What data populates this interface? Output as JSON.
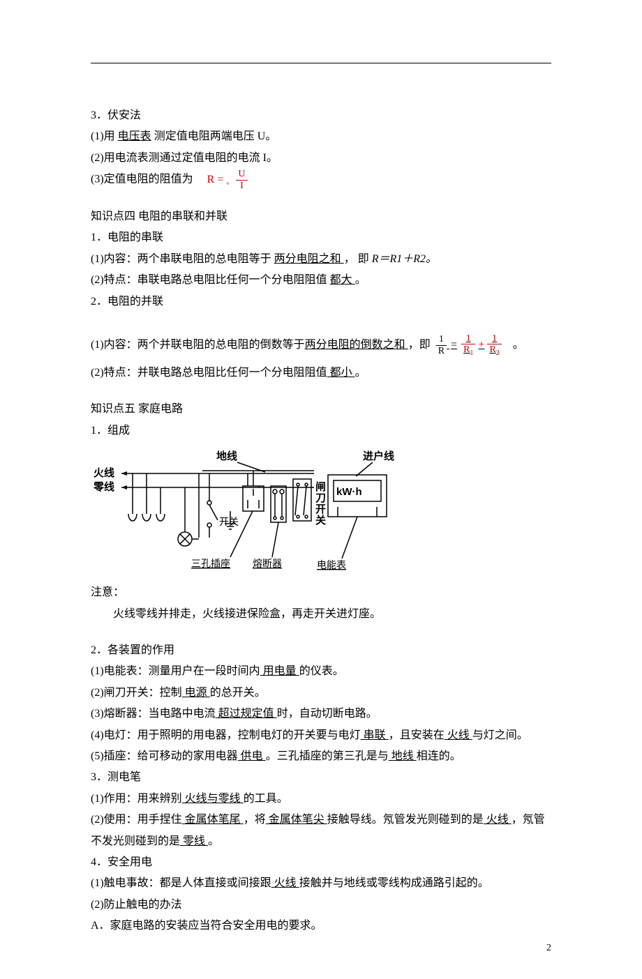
{
  "s3": {
    "title": "3．伏安法",
    "l1a": "(1)用 ",
    "l1u": "电压表",
    "l1b": " 测定值电阻两端电压 U。",
    "l2": "(2)用电流表测通过定值电阻的电流 I。",
    "l3a": "(3)定值电阻的阻值为",
    "f3_lhs": "R =",
    "f3_circle": "。",
    "f3_num": "U",
    "f3_den": "I"
  },
  "k4": {
    "head": "知识点四 电阻的串联和并联",
    "s1": "1．电阻的串联",
    "s1l1a": "(1)内容：两个串联电阻的总电阻等于 ",
    "s1l1u": "两分电阻之和 ",
    "s1l1b": "， 即 ",
    "s1l1eq": "R＝R1＋R2。",
    "s1l2a": "(2)特点：串联电路总电阻比任何一个分电阻阻值 ",
    "s1l2u": "都大 ",
    "s1l2b": "。",
    "s2": "2．电阻的并联",
    "s2l1a": "(1)内容：两个并联电阻的总电阻的倒数等于",
    "s2l1u": "两分电阻的倒数之和 ",
    "s2l1b": "，即",
    "s2l1end": "。",
    "s2l2a": "(2)特点：并联电路总电阻比任何一个分电阻阻值",
    "s2l2u": "  都小  ",
    "s2l2b": "。",
    "pf_lnum": "1",
    "pf_lden": "R",
    "pf_eq": "=",
    "pf_r1num": "1",
    "pf_r1den": "R",
    "pf_r1sub": "1",
    "pf_plus": "+",
    "pf_r2num": "1",
    "pf_r2den": "R",
    "pf_r2sub": "2"
  },
  "k5": {
    "head": "知识点五 家庭电路",
    "s1": "1．组成",
    "note_head": "注意：",
    "note_body": "火线零线并排走，火线接进保险盒，再走开关进灯座。",
    "s2": "2．各装置的作用",
    "d1a": "(1)电能表：测量用户在一段时间内",
    "d1u": "  用电量  ",
    "d1b": "的仪表。",
    "d2a": "(2)闸刀开关：控制",
    "d2u": " 电源 ",
    "d2b": "的总开关。",
    "d3a": "(3)熔断器：当电路中电流",
    "d3u": "  超过规定值   ",
    "d3b": "时，自动切断电路。",
    "d4a": "(4)电灯：用于照明的用电器，控制电灯的开关要与电灯",
    "d4u": " 串联 ",
    "d4b": "，且安装在",
    "d4u2": " 火线   ",
    "d4c": "与灯之间。",
    "d5a": "(5)插座：给可移动的家用电器",
    "d5u": "  供电 ",
    "d5b": "。三孔插座的第三孔是与",
    "d5u2": "   地线  ",
    "d5c": "相连的。",
    "s3": "3．测电笔",
    "t1a": "(1)作用：用来辨别",
    "t1u": " 火线与零线  ",
    "t1b": "的工具。",
    "t2a": "(2)使用：用手捏住",
    "t2u": " 金属体笔尾  ",
    "t2b": "，将",
    "t2u2": "  金属体笔尖   ",
    "t2c": "接触导线。氖管发光则碰到的是",
    "t2u3": " 火线  ",
    "t2d": "，氖管不发光则碰到的是",
    "t2u4": "  零线 ",
    "t2e": "。",
    "s4": "4．安全用电",
    "a1a": "(1)触电事故：都是人体直接或间接跟",
    "a1u": "  火线  ",
    "a1b": "接触并与地线或零线构成通路引起的。",
    "a2": "(2)防止触电的办法",
    "a3": "A．家庭电路的安装应当符合安全用电的要求。"
  },
  "diagram": {
    "ground": "地线",
    "incoming": "进户线",
    "live": "火线",
    "neutral": "零线",
    "kwh": "kW·h",
    "switch_label": "开关",
    "knife_l1": "闸",
    "knife_l2": "刀",
    "knife_l3": "开",
    "knife_l4": "关",
    "socket3": "三孔插座",
    "fuse": "熔断器",
    "meter": "电能表"
  },
  "pagenum": "2"
}
